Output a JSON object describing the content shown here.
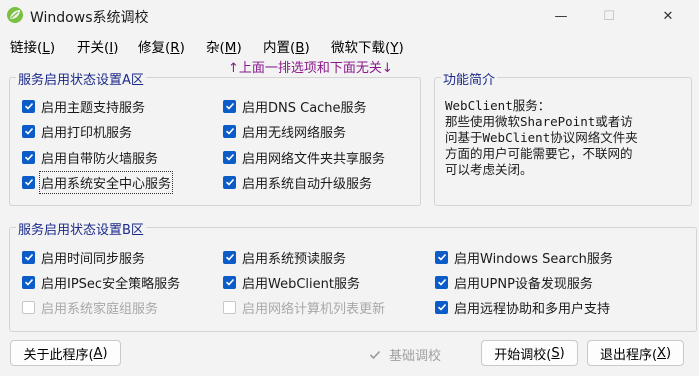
{
  "window": {
    "title": "Windows系统调校",
    "minimize": "—",
    "maximize": "☐",
    "close": "✕",
    "icon": "app-leaf-icon"
  },
  "menu": [
    {
      "label": "链接(",
      "key": "L",
      "tail": ")"
    },
    {
      "label": "开关(",
      "key": "I",
      "tail": ")"
    },
    {
      "label": "修复(",
      "key": "R",
      "tail": ")"
    },
    {
      "label": "杂(",
      "key": "M",
      "tail": ")"
    },
    {
      "label": "内置(",
      "key": "B",
      "tail": ")"
    },
    {
      "label": "微软下载(",
      "key": "Y",
      "tail": ")"
    }
  ],
  "hint": "↑上面一排选项和下面无关↓",
  "groupA": {
    "title": "服务启用状态设置A区",
    "items": [
      {
        "label": "启用主题支持服务",
        "checked": true
      },
      {
        "label": "启用DNS Cache服务",
        "checked": true
      },
      {
        "label": "启用打印机服务",
        "checked": true
      },
      {
        "label": "启用无线网络服务",
        "checked": true
      },
      {
        "label": "启用自带防火墙服务",
        "checked": true
      },
      {
        "label": "启用网络文件夹共享服务",
        "checked": true
      },
      {
        "label": "启用系统安全中心服务",
        "checked": true
      },
      {
        "label": "启用系统自动升级服务",
        "checked": true
      }
    ]
  },
  "info": {
    "title": "功能简介",
    "text": "WebClient服务：\n那些使用微软SharePoint或者访\n问基于WebClient协议网络文件夹\n方面的用户可能需要它，不联网的\n可以考虑关闭。"
  },
  "groupB": {
    "title": "服务启用状态设置B区",
    "items": [
      {
        "label": "启用时间同步服务",
        "checked": true
      },
      {
        "label": "启用系统预读服务",
        "checked": true
      },
      {
        "label": "启用Windows Search服务",
        "checked": true
      },
      {
        "label": "启用IPSec安全策略服务",
        "checked": true
      },
      {
        "label": "启用WebClient服务",
        "checked": true
      },
      {
        "label": "启用UPNP设备发现服务",
        "checked": true
      },
      {
        "label": "启用系统家庭组服务",
        "checked": false
      },
      {
        "label": "启用网络计算机列表更新",
        "checked": false
      },
      {
        "label": "启用远程协助和多用户支持",
        "checked": true
      }
    ]
  },
  "footer": {
    "about": {
      "label": "关于此程序(",
      "key": "A",
      "tail": ")"
    },
    "basic": "基础调校",
    "start": {
      "label": "开始调校(",
      "key": "S",
      "tail": ")"
    },
    "exit": {
      "label": "退出程序(",
      "key": "X",
      "tail": ")"
    }
  },
  "colors": {
    "accent": "#0c5cc7",
    "groupTitle": "#1c2a8a",
    "hint": "#8a1a8a"
  }
}
